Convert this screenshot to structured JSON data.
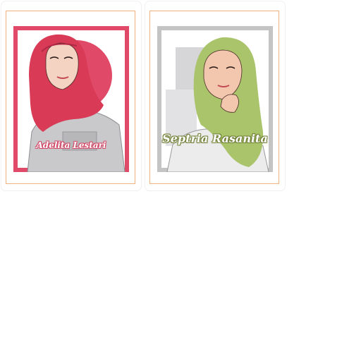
{
  "cards": [
    {
      "name": "Adelita Lestari",
      "colors": {
        "frame": "#e04a68",
        "circle": "#e04a68",
        "hijab": "#d93a56",
        "shirt": "#c9c9cb",
        "border": "#f0b17c"
      }
    },
    {
      "name": "Septria Rasanita",
      "colors": {
        "frame": "#c4c4c4",
        "hijab": "#a9c46a",
        "shirt": "#ececec",
        "border": "#f0b17c"
      }
    }
  ]
}
